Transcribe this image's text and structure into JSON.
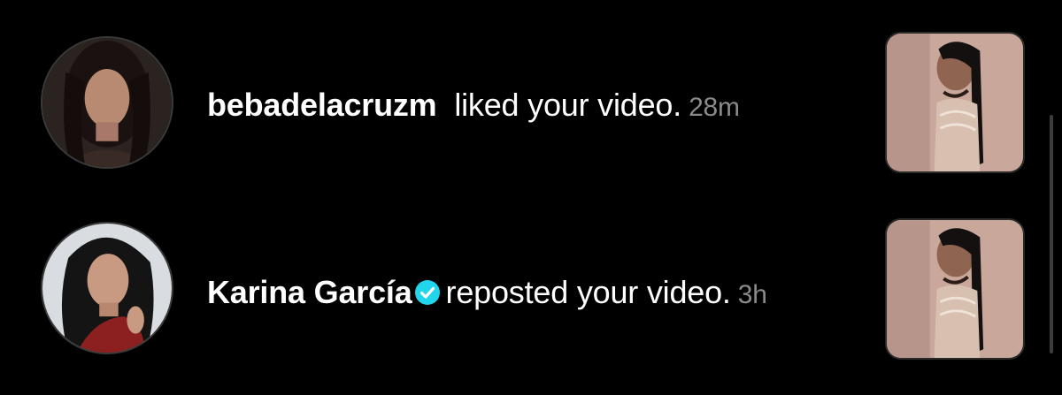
{
  "notifications": [
    {
      "username": "bebadelacruzm",
      "verified": false,
      "action": "liked your video.",
      "time": "28m",
      "avatar_icon": "user-avatar-portrait",
      "thumbnail_icon": "video-thumbnail"
    },
    {
      "username": "Karina García",
      "verified": true,
      "action": "reposted your video.",
      "time": "3h",
      "avatar_icon": "user-avatar-portrait",
      "thumbnail_icon": "video-thumbnail"
    }
  ],
  "colors": {
    "background": "#000000",
    "text": "#ffffff",
    "timestamp": "#8a8a8a",
    "verified_badge": "#20d5ec"
  }
}
